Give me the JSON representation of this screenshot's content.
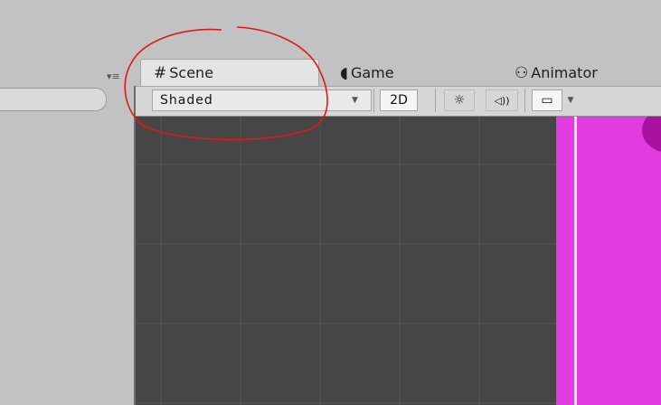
{
  "tabs": {
    "scene": {
      "icon": "#",
      "label": "Scene"
    },
    "game": {
      "icon": "◖",
      "label": "Game"
    },
    "animator": {
      "icon": "⚇",
      "label": "Animator"
    }
  },
  "toolbar": {
    "shading_mode": "Shaded",
    "mode_2d_label": "2D",
    "light_icon": "☼",
    "audio_icon": "◁))",
    "fx_icon": "▭"
  },
  "left_panel": {
    "menu_icon": "▾≡"
  },
  "colors": {
    "panel_gray": "#c2c2c2",
    "viewport_dark": "#464646",
    "magenta_object": "#e03cdf",
    "annotation_red": "#e01818"
  }
}
